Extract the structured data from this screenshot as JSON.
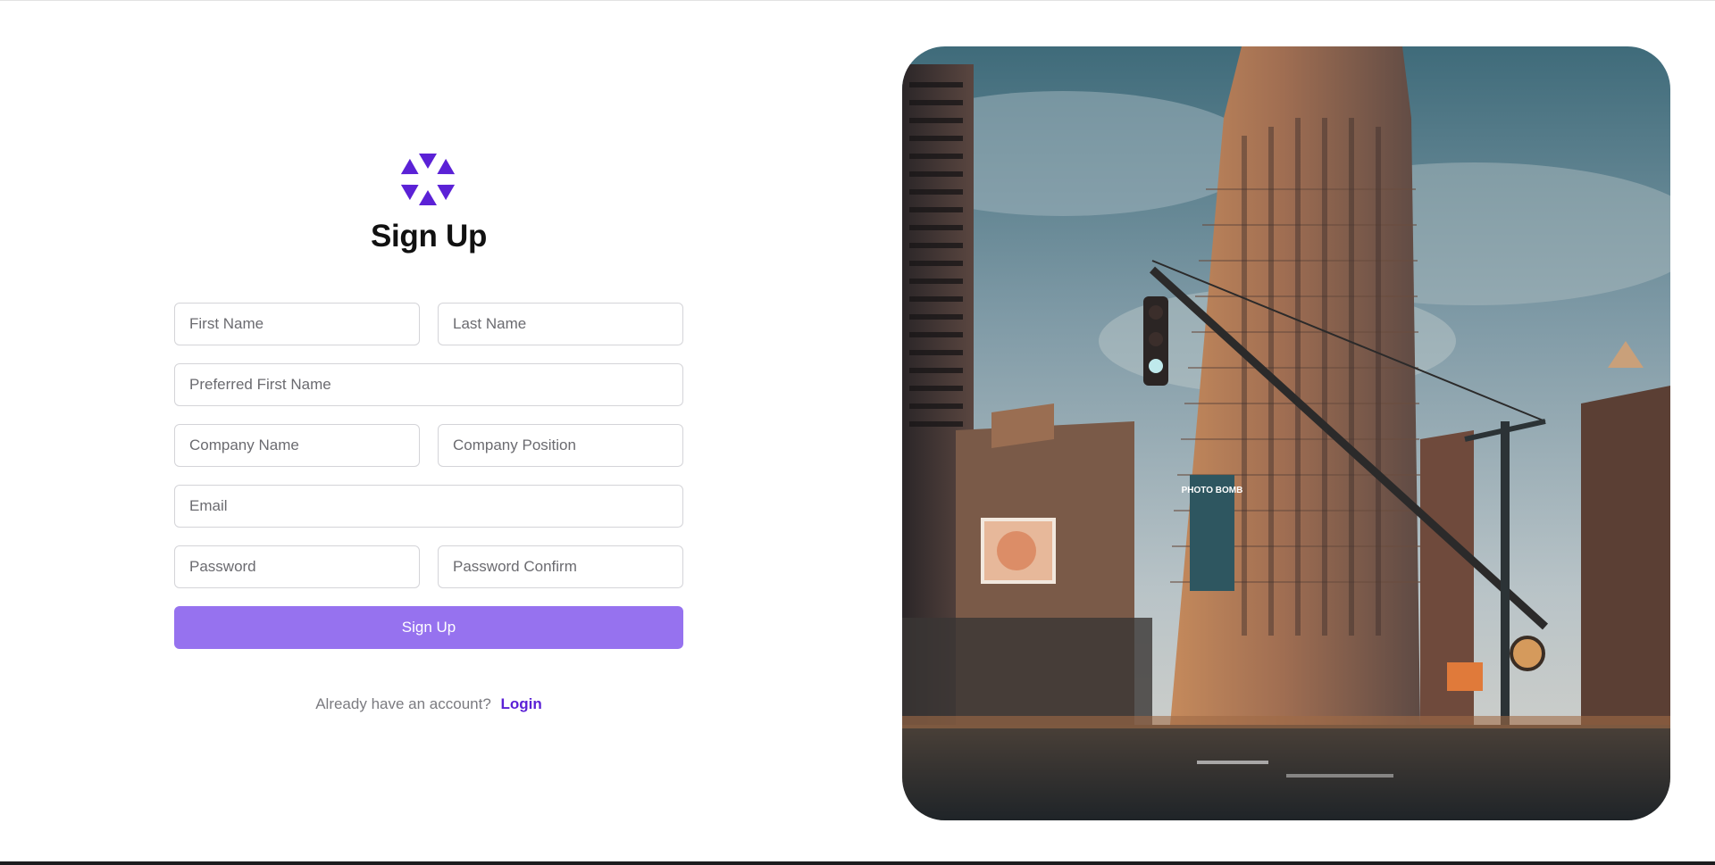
{
  "brand": {
    "logo_icon": "hexagon-triangles-logo-icon",
    "accent_color": "#5b21d6",
    "button_color": "#9672ef"
  },
  "signup": {
    "title": "Sign Up",
    "fields": {
      "first_name": "First Name",
      "last_name": "Last Name",
      "preferred_first_name": "Preferred First Name",
      "company_name": "Company Name",
      "company_position": "Company Position",
      "email": "Email",
      "password": "Password",
      "password_confirm": "Password Confirm"
    },
    "submit_label": "Sign Up",
    "login_prompt": "Already have an account?",
    "login_link": "Login"
  },
  "hero": {
    "image_name": "city-street-photo",
    "billboard_text": "PHOTO BOMB"
  }
}
